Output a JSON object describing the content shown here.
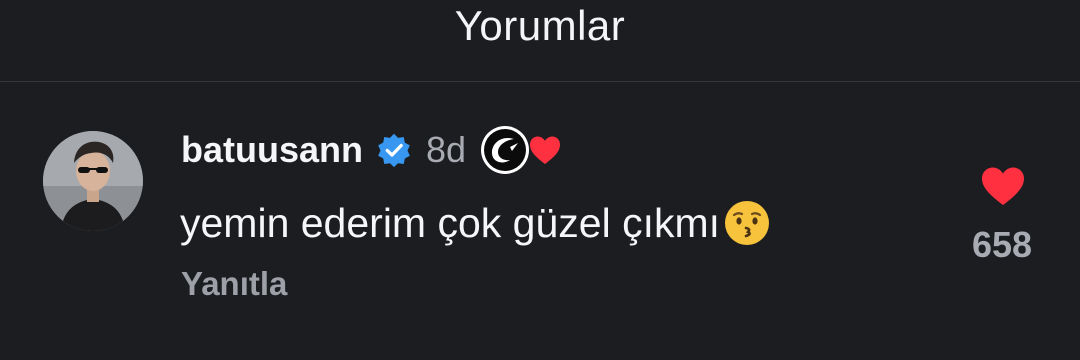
{
  "header": {
    "title": "Yorumlar"
  },
  "comment": {
    "username": "batuusann",
    "verified_icon": "verified-badge-icon",
    "age": "8d",
    "creator_badge_icon": "creator-logo-icon",
    "creator_liked_icon": "heart-icon",
    "text": "yemin ederim çok güzel çıkmı",
    "emoji": "kissing-face-emoji",
    "reply_label": "Yanıtla",
    "like_count": "658"
  },
  "colors": {
    "background": "#1b1d21",
    "verified": "#3897f0",
    "heart": "#ff3040",
    "muted_text": "#a9abb3"
  }
}
